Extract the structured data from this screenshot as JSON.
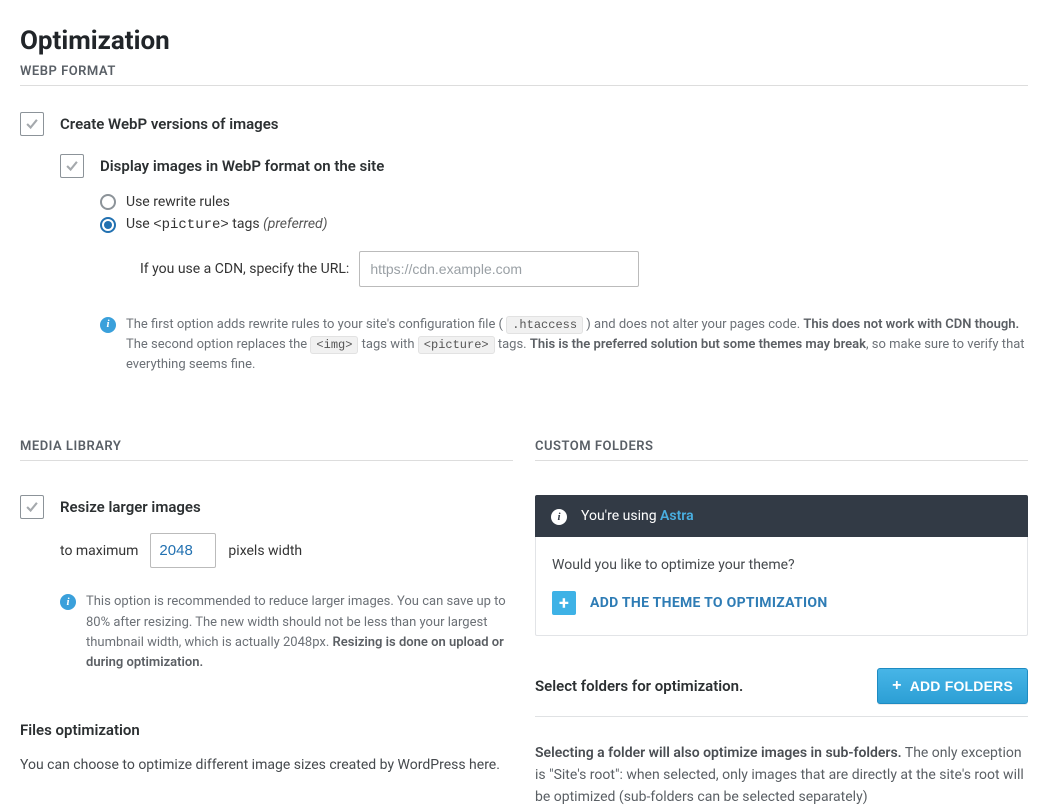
{
  "page": {
    "title": "Optimization"
  },
  "webp": {
    "section_header": "WEBP FORMAT",
    "create_label": "Create WebP versions of images",
    "display_label": "Display images in WebP format on the site",
    "radio_rewrite": "Use rewrite rules",
    "radio_picture_prefix": "Use ",
    "radio_picture_code": "<picture>",
    "radio_picture_suffix": " tags ",
    "radio_picture_preferred": "(preferred)",
    "cdn_label": "If you use a CDN, specify the URL:",
    "cdn_placeholder": "https://cdn.example.com",
    "info": {
      "part1": "The first option adds rewrite rules to your site's configuration file ( ",
      "code1": ".htaccess",
      "part2": " ) and does not alter your pages code. ",
      "bold1": "This does not work with CDN though.",
      "part3": "The second option replaces the ",
      "code2": "<img>",
      "part4": " tags with ",
      "code3": "<picture>",
      "part5": " tags. ",
      "bold2": "This is the preferred solution but some themes may break",
      "part6": ", so make sure to verify that everything seems fine."
    }
  },
  "media": {
    "section_header": "MEDIA LIBRARY",
    "resize_label": "Resize larger images",
    "to_max": "to maximum",
    "value": "2048",
    "px_width": "pixels width",
    "info": {
      "part1": "This option is recommended to reduce larger images. You can save up to 80% after resizing. The new width should not be less than your largest thumbnail width, which is actually 2048px. ",
      "bold1": "Resizing is done on upload or during optimization."
    },
    "files_opt_header": "Files optimization",
    "files_opt_text": "You can choose to optimize different image sizes created by WordPress here."
  },
  "custom": {
    "section_header": "CUSTOM FOLDERS",
    "banner_prefix": "You're using ",
    "banner_theme": "Astra",
    "box_question": "Would you like to optimize your theme?",
    "add_theme_label": "ADD THE THEME TO OPTIMIZATION",
    "select_folders_label": "Select folders for optimization.",
    "add_folders_label": "ADD FOLDERS",
    "help": {
      "bold1": "Selecting a folder will also optimize images in sub-folders.",
      "part1": " The only exception is \"Site's root\": when selected, only images that are directly at the site's root will be optimized (sub-folders can be selected separately)"
    }
  }
}
